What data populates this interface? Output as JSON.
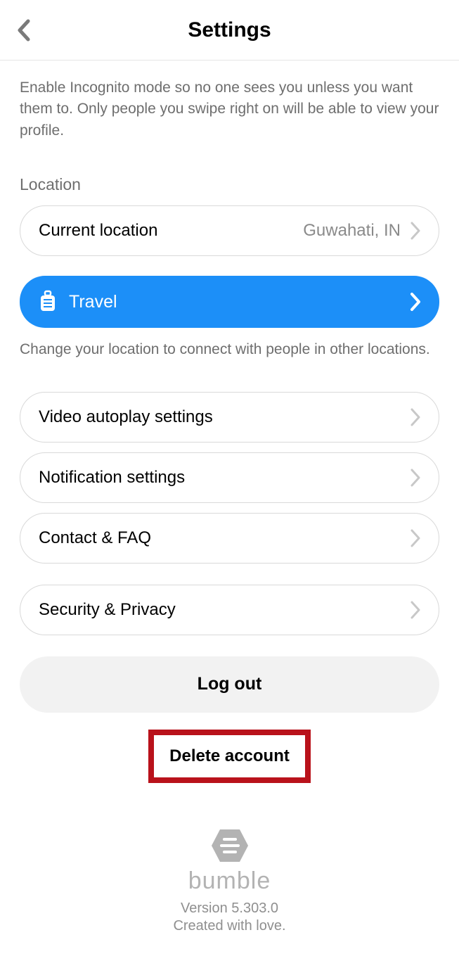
{
  "header": {
    "title": "Settings"
  },
  "incognito": {
    "description": "Enable Incognito mode so no one sees you unless you want them to. Only people you swipe right on will be able to view your profile."
  },
  "location": {
    "section_label": "Location",
    "current_label": "Current location",
    "current_value": "Guwahati, IN",
    "travel_label": "Travel",
    "travel_description": "Change your location to connect with people in other locations."
  },
  "rows": {
    "video_autoplay": "Video autoplay settings",
    "notification": "Notification settings",
    "contact_faq": "Contact & FAQ",
    "security_privacy": "Security & Privacy"
  },
  "actions": {
    "logout": "Log out",
    "delete": "Delete account"
  },
  "footer": {
    "brand": "bumble",
    "version": "Version 5.303.0",
    "created": "Created with love."
  }
}
